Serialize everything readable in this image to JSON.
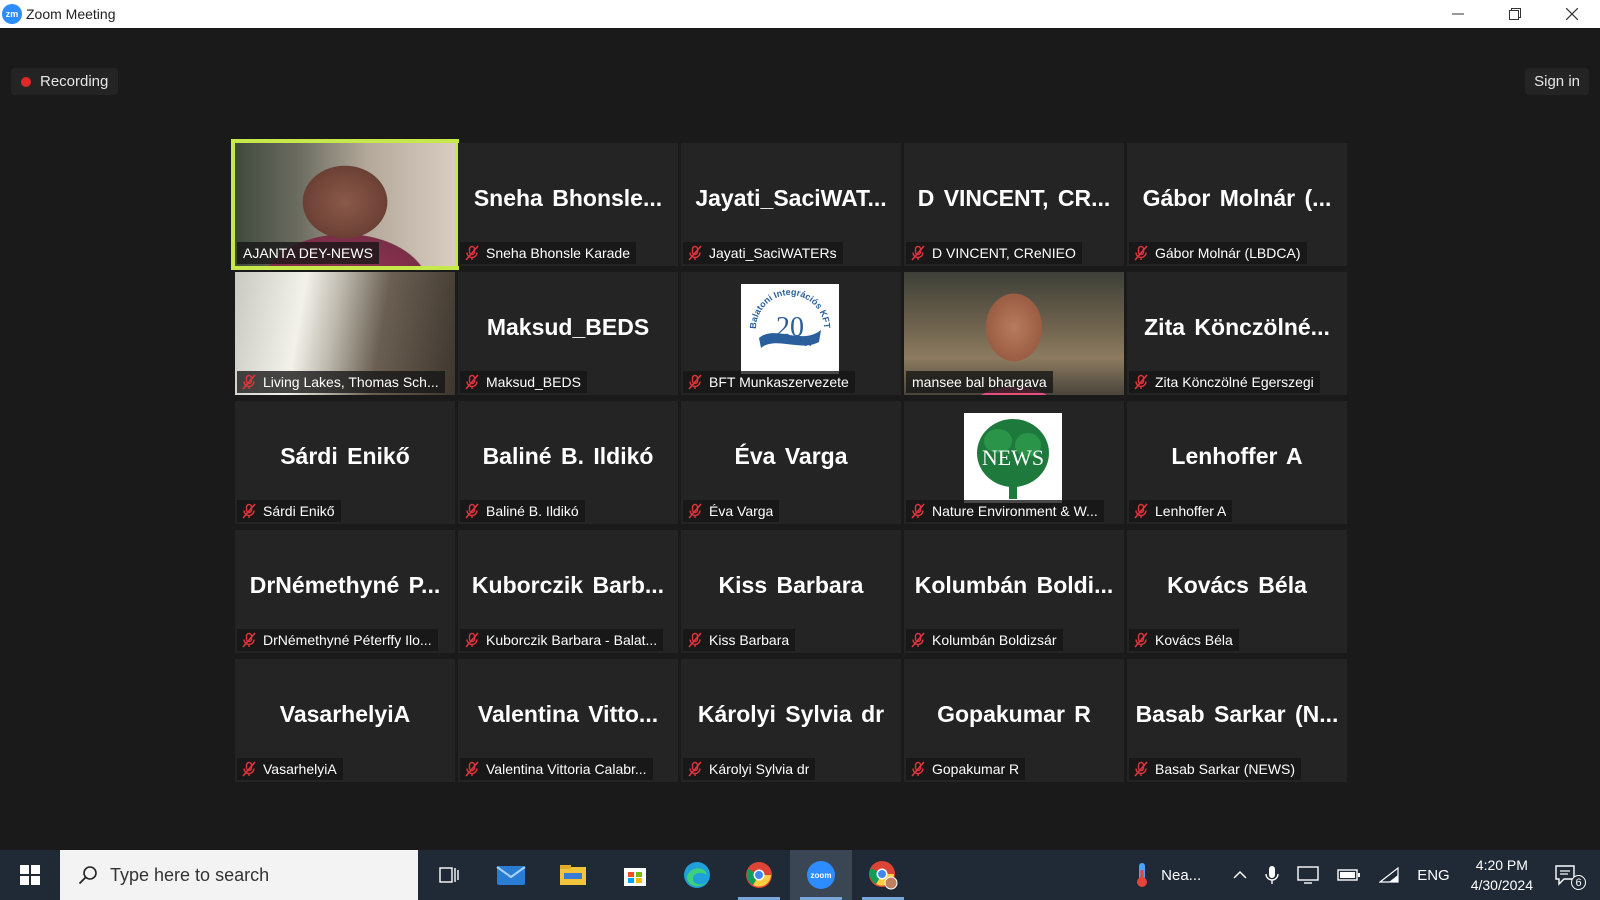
{
  "window": {
    "logo_text": "zm",
    "title": "Zoom Meeting"
  },
  "meeting": {
    "recording_label": "Recording",
    "signin_label": "Sign in"
  },
  "tiles": [
    {
      "big": "",
      "name": "AJANTA DEY-NEWS",
      "muted": false,
      "kind": "video-ajanta",
      "active": true
    },
    {
      "big": "Sneha  Bhonsle...",
      "name": "Sneha Bhonsle Karade",
      "muted": true
    },
    {
      "big": "Jayati_SaciWAT...",
      "name": "Jayati_SaciWATERs",
      "muted": true
    },
    {
      "big": "D  VINCENT,  CR...",
      "name": "D VINCENT, CReNIEO",
      "muted": true
    },
    {
      "big": "Gábor  Molnár  (...",
      "name": "Gábor Molnár (LBDCA)",
      "muted": true
    },
    {
      "big": "",
      "name": "Living Lakes, Thomas Sch...",
      "muted": true,
      "kind": "video-living"
    },
    {
      "big": "Maksud_BEDS",
      "name": "Maksud_BEDS",
      "muted": true
    },
    {
      "big": "",
      "name": "BFT Munkaszervezete",
      "muted": true,
      "kind": "logo-bft",
      "logo": {
        "ring_text": "Balatoni Integrációs KFT",
        "number": "20",
        "unit": "év"
      }
    },
    {
      "big": "",
      "name": "mansee bal bhargava",
      "muted": false,
      "kind": "video-mansee"
    },
    {
      "big": "Zita  Könczölné...",
      "name": "Zita Könczölné Egerszegi",
      "muted": true
    },
    {
      "big": "Sárdi Enikő",
      "name": "Sárdi Enikő",
      "muted": true
    },
    {
      "big": "Baliné B. Ildikó",
      "name": "Baliné B. Ildikó",
      "muted": true
    },
    {
      "big": "Éva Varga",
      "name": "Éva Varga",
      "muted": true
    },
    {
      "big": "",
      "name": "Nature Environment & W...",
      "muted": true,
      "kind": "logo-news",
      "logo": {
        "text": "NEWS"
      }
    },
    {
      "big": "Lenhoffer A",
      "name": "Lenhoffer A",
      "muted": true
    },
    {
      "big": "DrNémethyné  P...",
      "name": "DrNémethyné Péterffy Ilo...",
      "muted": true
    },
    {
      "big": "Kuborczik  Barb...",
      "name": "Kuborczik Barbara - Balat...",
      "muted": true
    },
    {
      "big": "Kiss Barbara",
      "name": "Kiss Barbara",
      "muted": true
    },
    {
      "big": "Kolumbán  Boldi...",
      "name": "Kolumbán Boldizsár",
      "muted": true
    },
    {
      "big": "Kovács Béla",
      "name": "Kovács Béla",
      "muted": true
    },
    {
      "big": "VasarhelyiA",
      "name": "VasarhelyiA",
      "muted": true
    },
    {
      "big": "Valentina   Vitto...",
      "name": "Valentina  Vittoria Calabr...",
      "muted": true
    },
    {
      "big": "Károlyi Sylvia dr",
      "name": "Károlyi Sylvia dr",
      "muted": true
    },
    {
      "big": "Gopakumar R",
      "name": "Gopakumar R",
      "muted": true
    },
    {
      "big": "Basab  Sarkar  (N...",
      "name": "Basab Sarkar (NEWS)",
      "muted": true
    }
  ],
  "colors": {
    "active_speaker_border": "#c7e84a",
    "muted_icon": "#e0343c",
    "tile_bg": "#242424",
    "meeting_bg": "#1a1a1a",
    "taskbar_bg": "#1f2a36"
  },
  "taskbar": {
    "search_placeholder": "Type here to search",
    "weather_label": "Nea...",
    "language": "ENG",
    "time": "4:20 PM",
    "date": "4/30/2024",
    "notification_count": "6",
    "zoom_icon_text": "zoom",
    "pinned": [
      "task-view-icon",
      "mail-icon",
      "file-explorer-icon",
      "store-icon",
      "edge-icon",
      "chrome-icon",
      "zoom-icon",
      "chrome-profile-icon"
    ]
  }
}
